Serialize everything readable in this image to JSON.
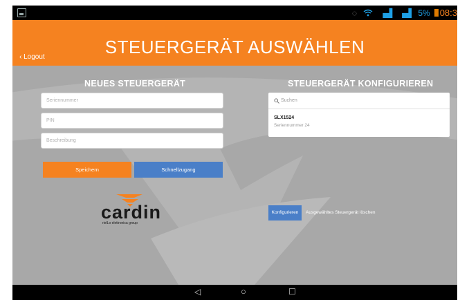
{
  "status_bar": {
    "battery_percent": "5%",
    "time": "08:3"
  },
  "header": {
    "title": "STEUERGERÄT AUSWÄHLEN",
    "back_label": "Logout"
  },
  "new_device": {
    "heading": "NEUES STEUERGERÄT",
    "fields": {
      "serial_placeholder": "Seriennummer",
      "pin_placeholder": "PIN",
      "description_placeholder": "Beschreibung"
    },
    "save_label": "Speichern",
    "quick_access_label": "Schnellzugang"
  },
  "configure": {
    "heading": "STEUERGERÄT KONFIGURIEREN",
    "search_placeholder": "Suchen",
    "devices": [
      {
        "name": "SLX1524",
        "serial": "Seriennummer 24"
      }
    ],
    "configure_label": "Konfigurieren",
    "delete_label": "Ausgewähltes Steuergerät löschen"
  },
  "logo": {
    "brand": "cardin",
    "tagline": "rielLo elettronica group"
  },
  "colors": {
    "accent_orange": "#f58220",
    "accent_blue": "#4a7fc8",
    "background_gray": "#a8a8a8",
    "status_blue": "#1ea0e6"
  }
}
